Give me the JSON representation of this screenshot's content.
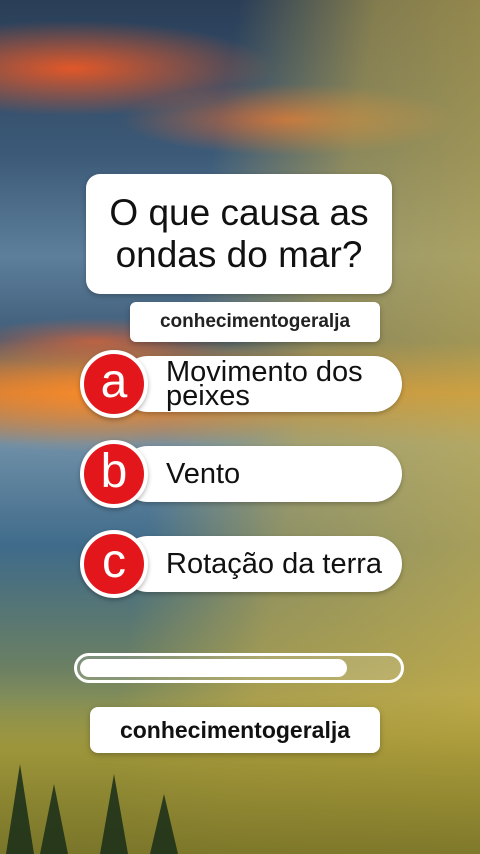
{
  "quiz": {
    "question": "O que causa as ondas do mar?",
    "handle_top": "conhecimentogeralja",
    "options": [
      {
        "letter": "a",
        "text": "Movimento dos peixes"
      },
      {
        "letter": "b",
        "text": "Vento"
      },
      {
        "letter": "c",
        "text": "Rotação da terra"
      }
    ],
    "progress": 0.84,
    "handle_bottom": "conhecimentogeralja"
  },
  "colors": {
    "letter_circle": "#e3161b",
    "card": "#ffffff"
  }
}
